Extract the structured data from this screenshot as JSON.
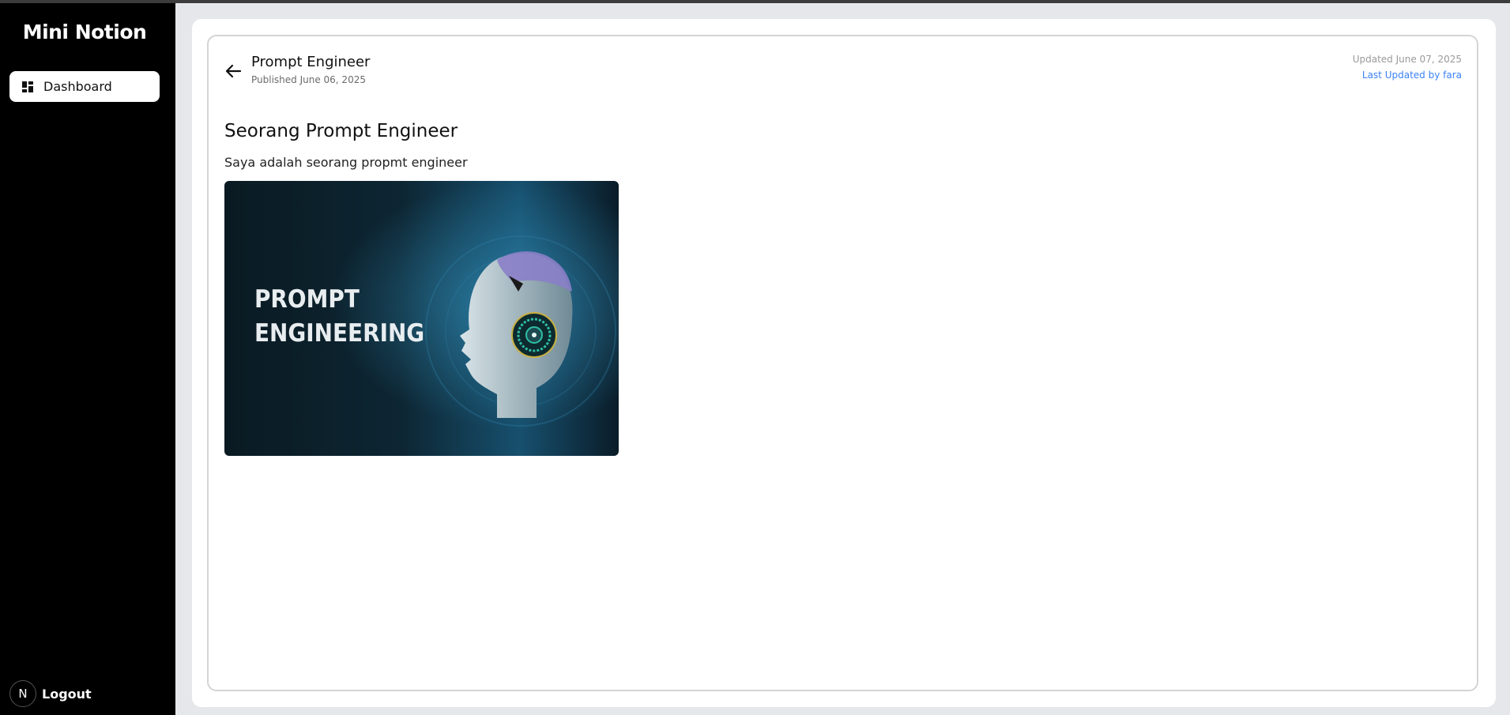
{
  "sidebar": {
    "brand": "Mini Notion",
    "items": [
      {
        "label": "Dashboard",
        "icon": "dashboard-grid-icon"
      }
    ],
    "logout": {
      "avatar_letter": "N",
      "label": "Logout"
    }
  },
  "header": {
    "title": "Prompt Engineer",
    "published": "Published June 06, 2025",
    "updated": "Updated June 07, 2025",
    "updated_by": "Last Updated by fara"
  },
  "document": {
    "title": "Seorang Prompt Engineer",
    "body": "Saya adalah seorang propmt engineer",
    "image_text_line1": "PROMPT",
    "image_text_line2": "ENGINEERING"
  },
  "colors": {
    "sidebar_bg": "#000000",
    "accent_link": "#3b82f6",
    "page_bg": "#e6e7eb"
  }
}
